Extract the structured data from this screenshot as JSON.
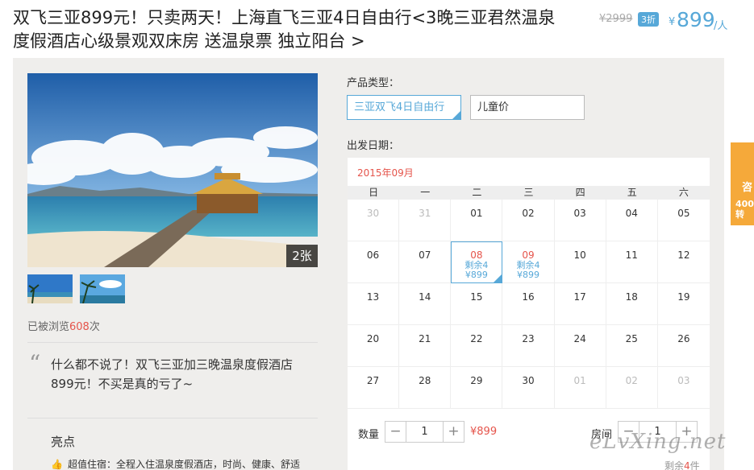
{
  "product": {
    "title": "双飞三亚899元！只卖两天！上海直飞三亚4日自由行<3晚三亚君然温泉度假酒店心级景观双床房 送温泉票 独立阳台 >",
    "original_price": "¥2999",
    "discount": "3折",
    "currency": "¥",
    "price": "899",
    "price_unit": "/人"
  },
  "gallery": {
    "photo_count": "2张",
    "views_prefix": "已被浏览",
    "views_count": "608",
    "views_suffix": "次"
  },
  "description": {
    "quote": "什么都不说了！双飞三亚加三晚温泉度假酒店899元！不买是真的亏了~",
    "highlights_title": "亮点",
    "highlight_1": "超值住宿：全程入住温泉度假酒店，时尚、健康、舒适"
  },
  "booking": {
    "type_label": "产品类型：",
    "type_options": [
      "三亚双飞4日自由行",
      "儿童价"
    ],
    "date_label": "出发日期：",
    "month": "2015年09月",
    "weekdays": [
      "日",
      "一",
      "二",
      "三",
      "四",
      "五",
      "六"
    ],
    "days": [
      {
        "d": "30",
        "muted": true
      },
      {
        "d": "31",
        "muted": true
      },
      {
        "d": "01"
      },
      {
        "d": "02"
      },
      {
        "d": "03"
      },
      {
        "d": "04"
      },
      {
        "d": "05"
      },
      {
        "d": "06"
      },
      {
        "d": "07"
      },
      {
        "d": "08",
        "rem": "剩余4",
        "pr": "¥899",
        "selected": true
      },
      {
        "d": "09",
        "rem": "剩余4",
        "pr": "¥899"
      },
      {
        "d": "10"
      },
      {
        "d": "11"
      },
      {
        "d": "12"
      },
      {
        "d": "13"
      },
      {
        "d": "14"
      },
      {
        "d": "15"
      },
      {
        "d": "16"
      },
      {
        "d": "17"
      },
      {
        "d": "18"
      },
      {
        "d": "19"
      },
      {
        "d": "20"
      },
      {
        "d": "21"
      },
      {
        "d": "22"
      },
      {
        "d": "23"
      },
      {
        "d": "24"
      },
      {
        "d": "25"
      },
      {
        "d": "26"
      },
      {
        "d": "27"
      },
      {
        "d": "28"
      },
      {
        "d": "29"
      },
      {
        "d": "30"
      },
      {
        "d": "01",
        "muted": true
      },
      {
        "d": "02",
        "muted": true
      },
      {
        "d": "03",
        "muted": true
      }
    ],
    "quantity_label": "数量",
    "quantity": "1",
    "subtotal": "¥899",
    "rooms_label": "房间",
    "rooms": "1",
    "remaining_prefix": "剩余",
    "remaining_count": "4",
    "remaining_suffix": "件",
    "minus": "−",
    "plus": "+"
  },
  "side_tab": {
    "line1": "咨",
    "line2": "400\n转"
  },
  "watermark": "eLvXing.net",
  "colors": {
    "accent_blue": "#57a8d8",
    "price_red": "#e5544b",
    "side_orange": "#f5a93a"
  }
}
